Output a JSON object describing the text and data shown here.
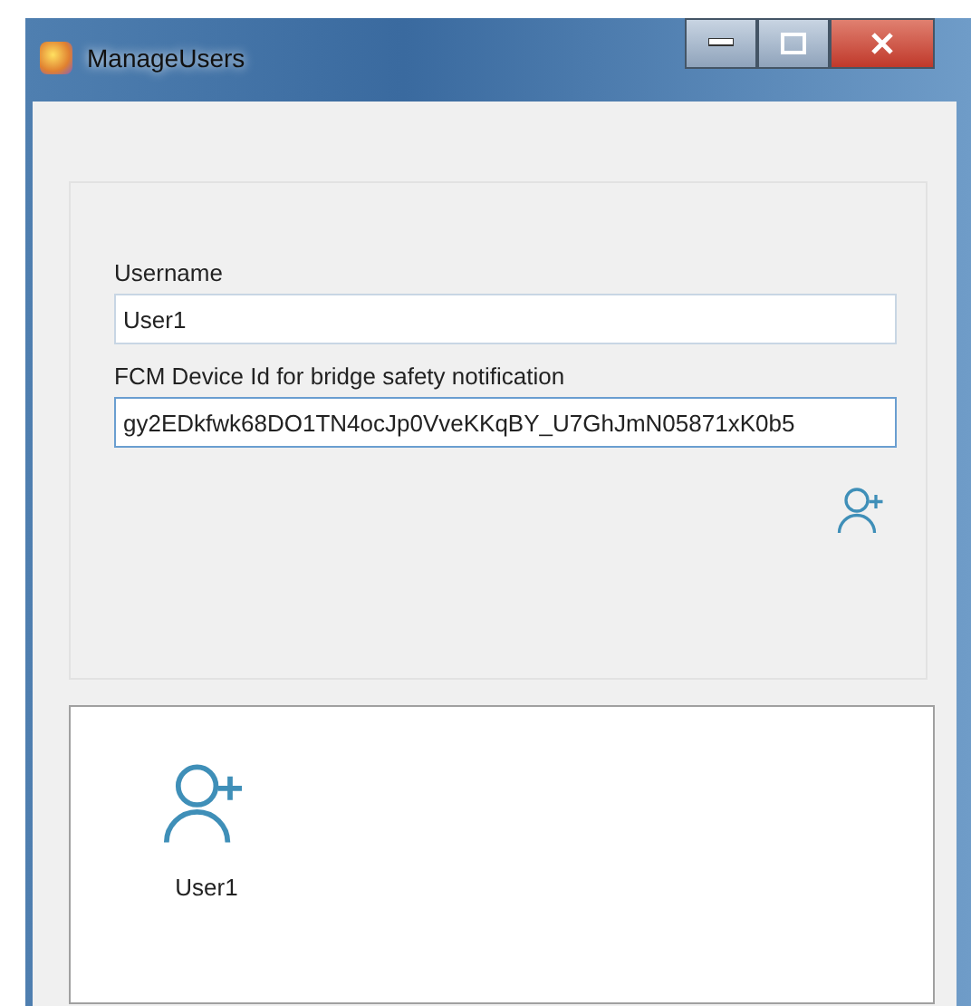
{
  "window": {
    "title": "ManageUsers"
  },
  "form": {
    "fields": [
      {
        "label": "Username",
        "value": "User1"
      },
      {
        "label": "FCM Device Id for bridge safety notification",
        "value": "gy2EDkfwk68DO1TN4ocJp0VveKKqBY_U7GhJmN05871xK0b5"
      }
    ]
  },
  "users": [
    {
      "name": "User1"
    }
  ]
}
